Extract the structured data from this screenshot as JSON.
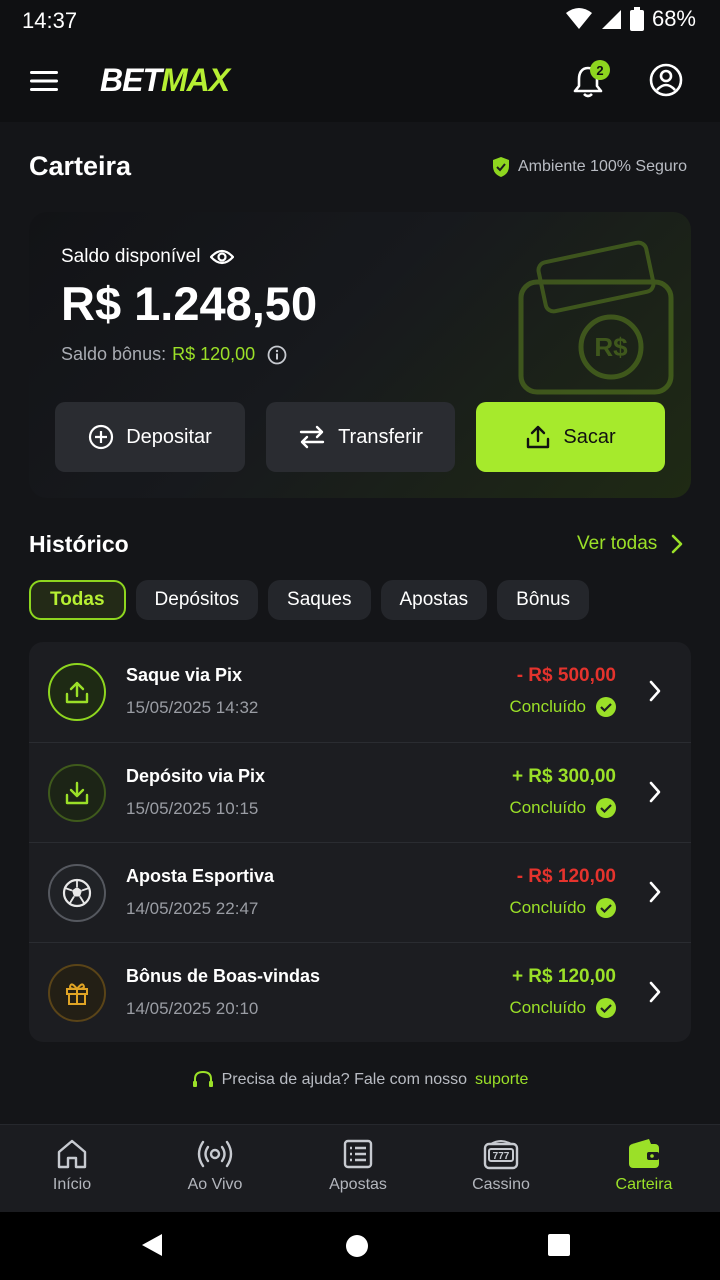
{
  "status_bar": {
    "time": "14:37",
    "battery": "68%"
  },
  "header": {
    "logo_part1": "BET",
    "logo_part2": "MAX",
    "notification_count": "2"
  },
  "page": {
    "title": "Carteira",
    "secure_label": "Ambiente 100% Seguro"
  },
  "balance": {
    "label": "Saldo disponível",
    "value": "R$ 1.248,50",
    "bonus_label": "Saldo bônus:",
    "bonus_value": "R$ 120,00",
    "deposit_label": "Depositar",
    "transfer_label": "Transferir",
    "withdraw_label": "Sacar"
  },
  "history": {
    "title": "Histórico",
    "see_all": "Ver todas",
    "filters": [
      "Todas",
      "Depósitos",
      "Saques",
      "Apostas",
      "Bônus"
    ],
    "transactions": [
      {
        "title": "Saque via Pix",
        "date": "15/05/2025 14:32",
        "amount": "- R$ 500,00",
        "status": "Concluído",
        "icon": "upload-icon"
      },
      {
        "title": "Depósito via Pix",
        "date": "15/05/2025 10:15",
        "amount": "+ R$ 300,00",
        "status": "Concluído",
        "icon": "download-icon"
      },
      {
        "title": "Aposta Esportiva",
        "date": "14/05/2025 22:47",
        "amount": "- R$ 120,00",
        "status": "Concluído",
        "icon": "soccer-ball-icon"
      },
      {
        "title": "Bônus de Boas-vindas",
        "date": "14/05/2025 20:10",
        "amount": "+ R$ 120,00",
        "status": "Concluído",
        "icon": "gift-icon"
      }
    ]
  },
  "help": {
    "text": "Precisa de ajuda? Fale com nosso",
    "link": "suporte"
  },
  "bottom_nav": [
    {
      "label": "Início",
      "icon": "home-icon"
    },
    {
      "label": "Ao Vivo",
      "icon": "live-icon"
    },
    {
      "label": "Apostas",
      "icon": "bets-icon"
    },
    {
      "label": "Cassino",
      "icon": "slot-icon"
    },
    {
      "label": "Carteira",
      "icon": "wallet-icon"
    }
  ],
  "colors": {
    "accent": "#a6ea2c",
    "negative": "#e5332d",
    "positive": "#9be028",
    "gold": "#e0a425"
  }
}
